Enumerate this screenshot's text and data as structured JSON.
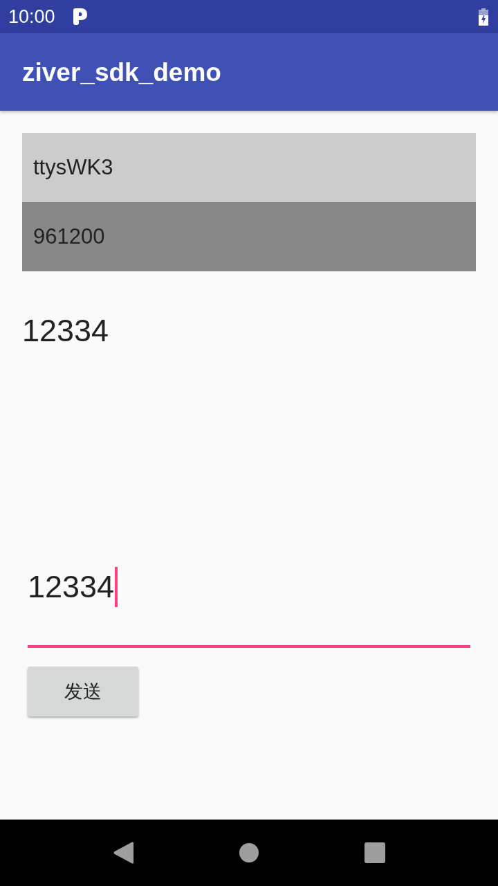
{
  "status_bar": {
    "time": "10:00"
  },
  "app_bar": {
    "title": "ziver_sdk_demo"
  },
  "list": {
    "items": [
      {
        "label": "ttysWK3",
        "selected": false
      },
      {
        "label": "961200",
        "selected": true
      }
    ]
  },
  "received_text": "12334",
  "message_input": {
    "value": "12334",
    "focused": true
  },
  "send_button": {
    "label": "发送"
  }
}
